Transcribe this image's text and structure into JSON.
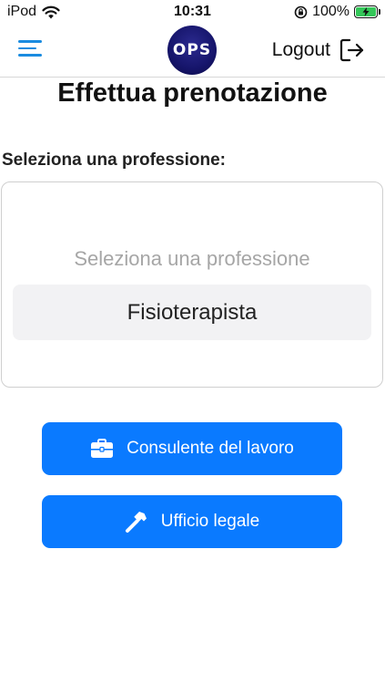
{
  "status_bar": {
    "carrier": "iPod",
    "time": "10:31",
    "battery": "100%",
    "icons": [
      "wifi-icon",
      "rotation-lock-icon",
      "battery-charging-icon"
    ]
  },
  "nav": {
    "logo_text": "OPS",
    "logout_label": "Logout",
    "icons": [
      "menu-icon",
      "logout-icon"
    ]
  },
  "page": {
    "title": "Effettua prenotazione",
    "section_label": "Seleziona una professione:"
  },
  "picker": {
    "placeholder": "Seleziona una professione",
    "selected": "Fisioterapista"
  },
  "buttons": [
    {
      "label": "Consulente del lavoro",
      "icon": "briefcase-icon"
    },
    {
      "label": "Ufficio legale",
      "icon": "hammer-icon"
    }
  ],
  "colors": {
    "accent": "#0a7aff",
    "menu": "#1a8be0",
    "logo_bg": "#16156b",
    "battery_fill": "#34c759"
  }
}
